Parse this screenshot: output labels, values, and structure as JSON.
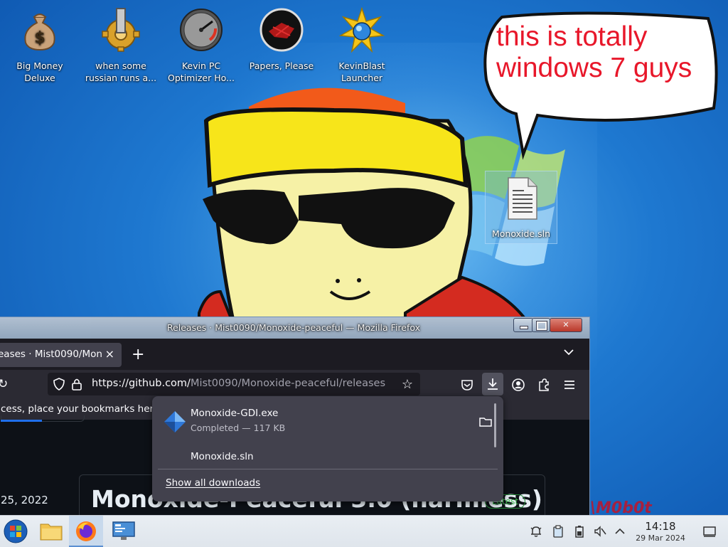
{
  "desktop": {
    "icons": [
      {
        "label": "Big Money\nDeluxe",
        "icon": "money-bag-icon"
      },
      {
        "label": "when some\nrussian runs a...",
        "icon": "gears-icon"
      },
      {
        "label": "Kevin PC\nOptimizer Ho...",
        "icon": "speedometer-icon"
      },
      {
        "label": "Papers, Please",
        "icon": "red-seal-icon"
      },
      {
        "label": "KevinBlast\nLauncher",
        "icon": "starburst-icon"
      },
      {
        "label": "Monoxide.sln",
        "icon": "document-icon"
      }
    ],
    "speech_bubble": "this is totally windows 7 guys",
    "watermark": "\\M0b0t"
  },
  "firefox": {
    "window_title": "Releases · Mist0090/Monoxide-peaceful — Mozilla Firefox",
    "tab_title": "eases · Mist0090/Mon",
    "tab_close": "×",
    "new_tab": "+",
    "tab_list": "⌄",
    "url_host": "https://github.com/",
    "url_path": "Mist0090/Monoxide-peaceful/releases",
    "bookmarks_hint": "cess, place your bookmarks here",
    "page": {
      "release_date": "25, 2022",
      "release_title": "Monoxide-Peaceful 3.0 (harmless)",
      "latest_badge": "Latest"
    }
  },
  "downloads": {
    "items": [
      {
        "name": "Monoxide-GDI.exe",
        "status": "Completed — 117 KB"
      },
      {
        "name": "Monoxide.sln",
        "status": ""
      }
    ],
    "show_all": "Show all downloads"
  },
  "taskbar": {
    "time": "14:18",
    "date": "29 Mar 2024"
  },
  "colors": {
    "accent": "#5b8fd1",
    "bubble_text": "#e8172a",
    "firefox_dark": "#1c1b22",
    "github_green": "#3fb950"
  }
}
